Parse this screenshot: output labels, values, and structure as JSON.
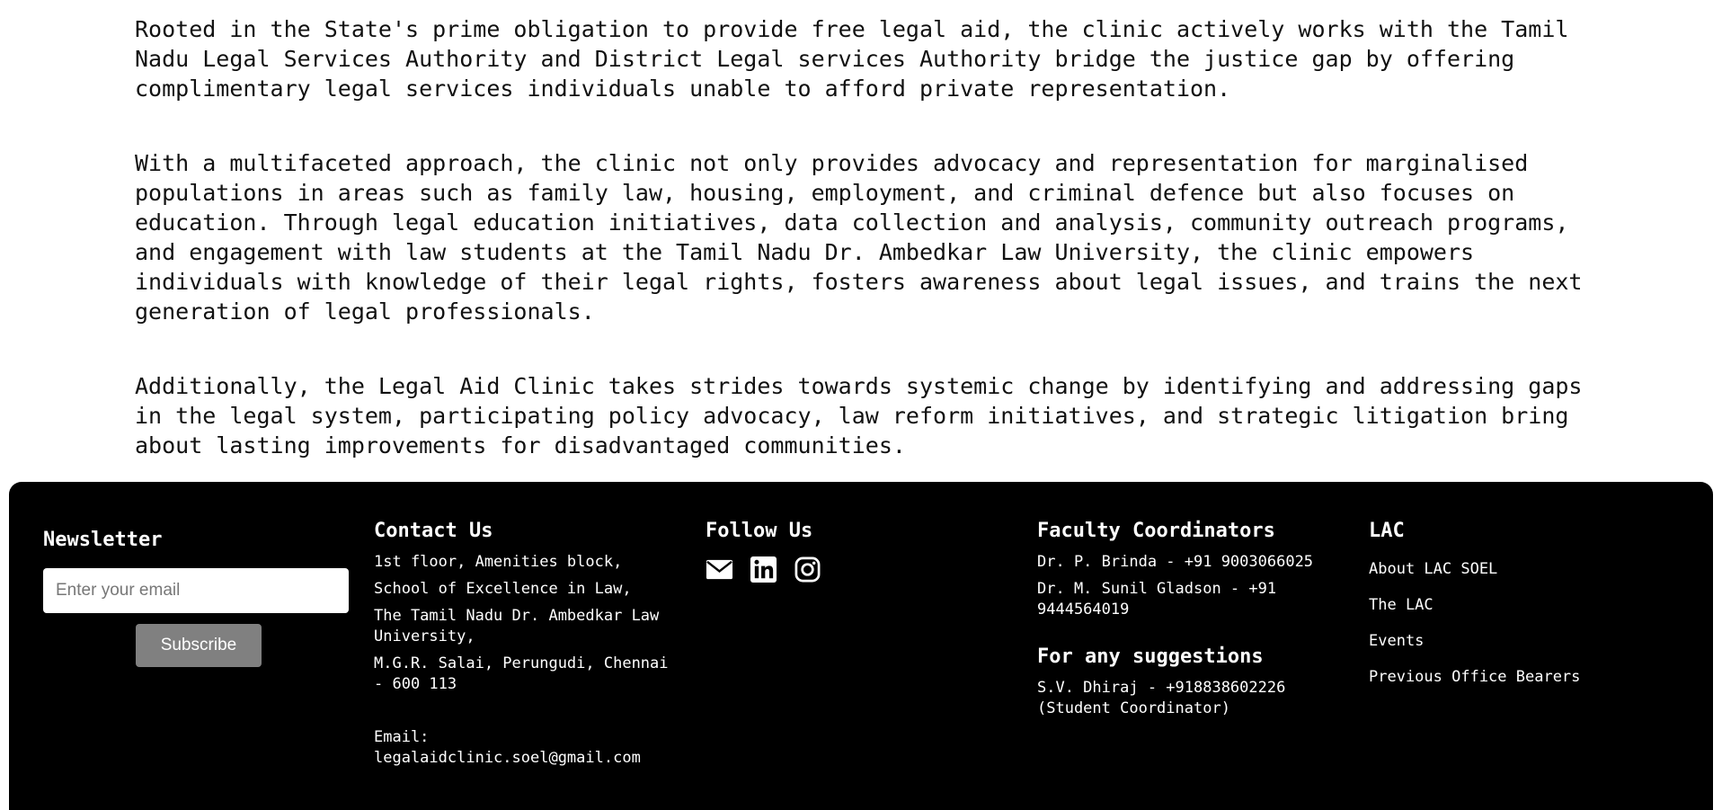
{
  "content": {
    "paragraphs": [
      "Rooted in the State's prime obligation to provide free legal aid, the clinic actively works with the Tamil\nNadu Legal Services Authority and District Legal services Authority bridge the justice gap by offering\ncomplimentary legal services individuals unable to afford private representation.",
      "With a multifaceted approach, the clinic not only provides advocacy and representation for marginalised\npopulations in areas such as family law, housing, employment, and criminal defence but also focuses on\neducation. Through legal education initiatives, data collection and analysis, community outreach programs,\nand engagement with law students at the Tamil Nadu Dr. Ambedkar Law University, the clinic empowers\nindividuals with knowledge of their legal rights, fosters awareness about legal issues, and trains the next\ngeneration of legal professionals.",
      "Additionally, the Legal Aid Clinic takes strides towards systemic change by identifying and addressing gaps\nin the legal system, participating policy advocacy, law reform initiatives, and strategic litigation bring\nabout lasting improvements for disadvantaged communities."
    ]
  },
  "footer": {
    "background": "#000000",
    "newsletter": {
      "title": "Newsletter",
      "email_placeholder": "Enter your email",
      "subscribe_label": "Subscribe",
      "button_color": "#808080"
    },
    "contact": {
      "title": "Contact Us",
      "address_lines": [
        "1st floor, Amenities block,",
        "School of Excellence in Law,",
        "The Tamil Nadu Dr. Ambedkar Law University,",
        "M.G.R. Salai, Perungudi, Chennai - 600 113"
      ],
      "email_label": "Email:",
      "email": "legalaidclinic.soel@gmail.com"
    },
    "follow": {
      "title": "Follow Us",
      "icons": [
        "mail-icon",
        "linkedin-icon",
        "instagram-icon"
      ]
    },
    "faculty": {
      "title": "Faculty Coordinators",
      "coordinators": [
        "Dr. P. Brinda - +91 9003066025",
        "Dr. M. Sunil Gladson - +91 9444564019"
      ],
      "suggestions_title": "For any suggestions",
      "suggestions_contact": "S.V. Dhiraj - +918838602226 (Student Coordinator)"
    },
    "lac": {
      "title": "LAC",
      "links": [
        "About LAC SOEL",
        "The LAC",
        "Events",
        "Previous Office Bearers"
      ]
    }
  }
}
